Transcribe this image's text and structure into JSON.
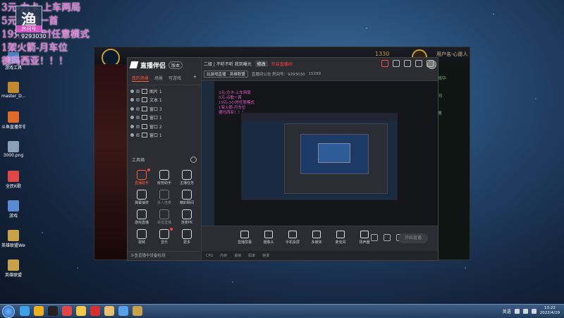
{
  "overlay": {
    "lines": [
      "3元-力卡-上车两局",
      "5元-点歌一首",
      "19元-3小时任意模式",
      "1架火箭-月车位",
      "德玛西亚！！！"
    ],
    "logo_text": "渔",
    "logo_sub": "房间号",
    "room_id": "9293030"
  },
  "desktop": {
    "icons": [
      {
        "label": "游戏工具",
        "color": "#4a7fc0"
      },
      {
        "label": "master_D...",
        "color": "#c08a30"
      },
      {
        "label": "斗鱼直播伴侣",
        "color": "#e06a2a"
      },
      {
        "label": "3000.png",
        "color": "#8aa0b8"
      },
      {
        "label": "全民K歌",
        "color": "#e04848"
      },
      {
        "label": "游戏",
        "color": "#5a8ad0"
      },
      {
        "label": "英雄联盟WeGame版",
        "color": "#c8a24a"
      },
      {
        "label": "英雄联盟",
        "color": "#c8a24a"
      }
    ]
  },
  "lol_client": {
    "coins": "1330",
    "user": "用户名-心愿人",
    "right_items": [
      "在线中",
      "房间",
      "开黑"
    ]
  },
  "stream_app": {
    "brand": "直播伴侣",
    "version": "版本",
    "tabs": [
      "我的场景",
      "场景",
      "可游戏"
    ],
    "tab_add": "+",
    "scenes": [
      "图片 1",
      "文本 1",
      "窗口 3",
      "窗口 1",
      "窗口 2",
      "窗口 1"
    ],
    "tools_title": "工具箱",
    "tools": [
      "直播助手",
      "房管助手",
      "主播任务",
      "弹幕抽奖",
      "多人连麦",
      "精彩瞬间",
      "游戏直播",
      "语音直播",
      "连麦PK",
      "视频",
      "音乐",
      "更多"
    ],
    "bottom_text": "斗鱼直播中设备检测",
    "top": {
      "status": "二级 | 不听不听 我到曝光",
      "tag": "修改",
      "live": "开启直播间",
      "category": "玩游戏直播 · 英雄联盟",
      "room_info": "直播间公告 房间号：9293030",
      "fans": "15299"
    },
    "controls": [
      "直播屏幕",
      "摄像头",
      "手机投屏",
      "多媒体",
      "麦克风",
      "扬声器"
    ],
    "go_live": "开始直播",
    "status_items": [
      "CPU",
      "内存",
      "丢帧",
      "码率",
      "帧率"
    ]
  },
  "taskbar": {
    "ime": "英语",
    "time": "13:22",
    "date": "2022/4/29",
    "apps": [
      {
        "name": "ie-icon",
        "color": "#3ea0e8"
      },
      {
        "name": "browser-icon",
        "color": "#f0b020"
      },
      {
        "name": "g-icon",
        "color": "#222222"
      },
      {
        "name": "qq-icon",
        "color": "#e04848"
      },
      {
        "name": "glasses-icon",
        "color": "#f2c84a"
      },
      {
        "name": "netease-icon",
        "color": "#d83030"
      },
      {
        "name": "folder-icon",
        "color": "#e8c070"
      },
      {
        "name": "windows-icon",
        "color": "#5aa0e8"
      },
      {
        "name": "lol-icon",
        "color": "#c8a24a"
      }
    ]
  }
}
